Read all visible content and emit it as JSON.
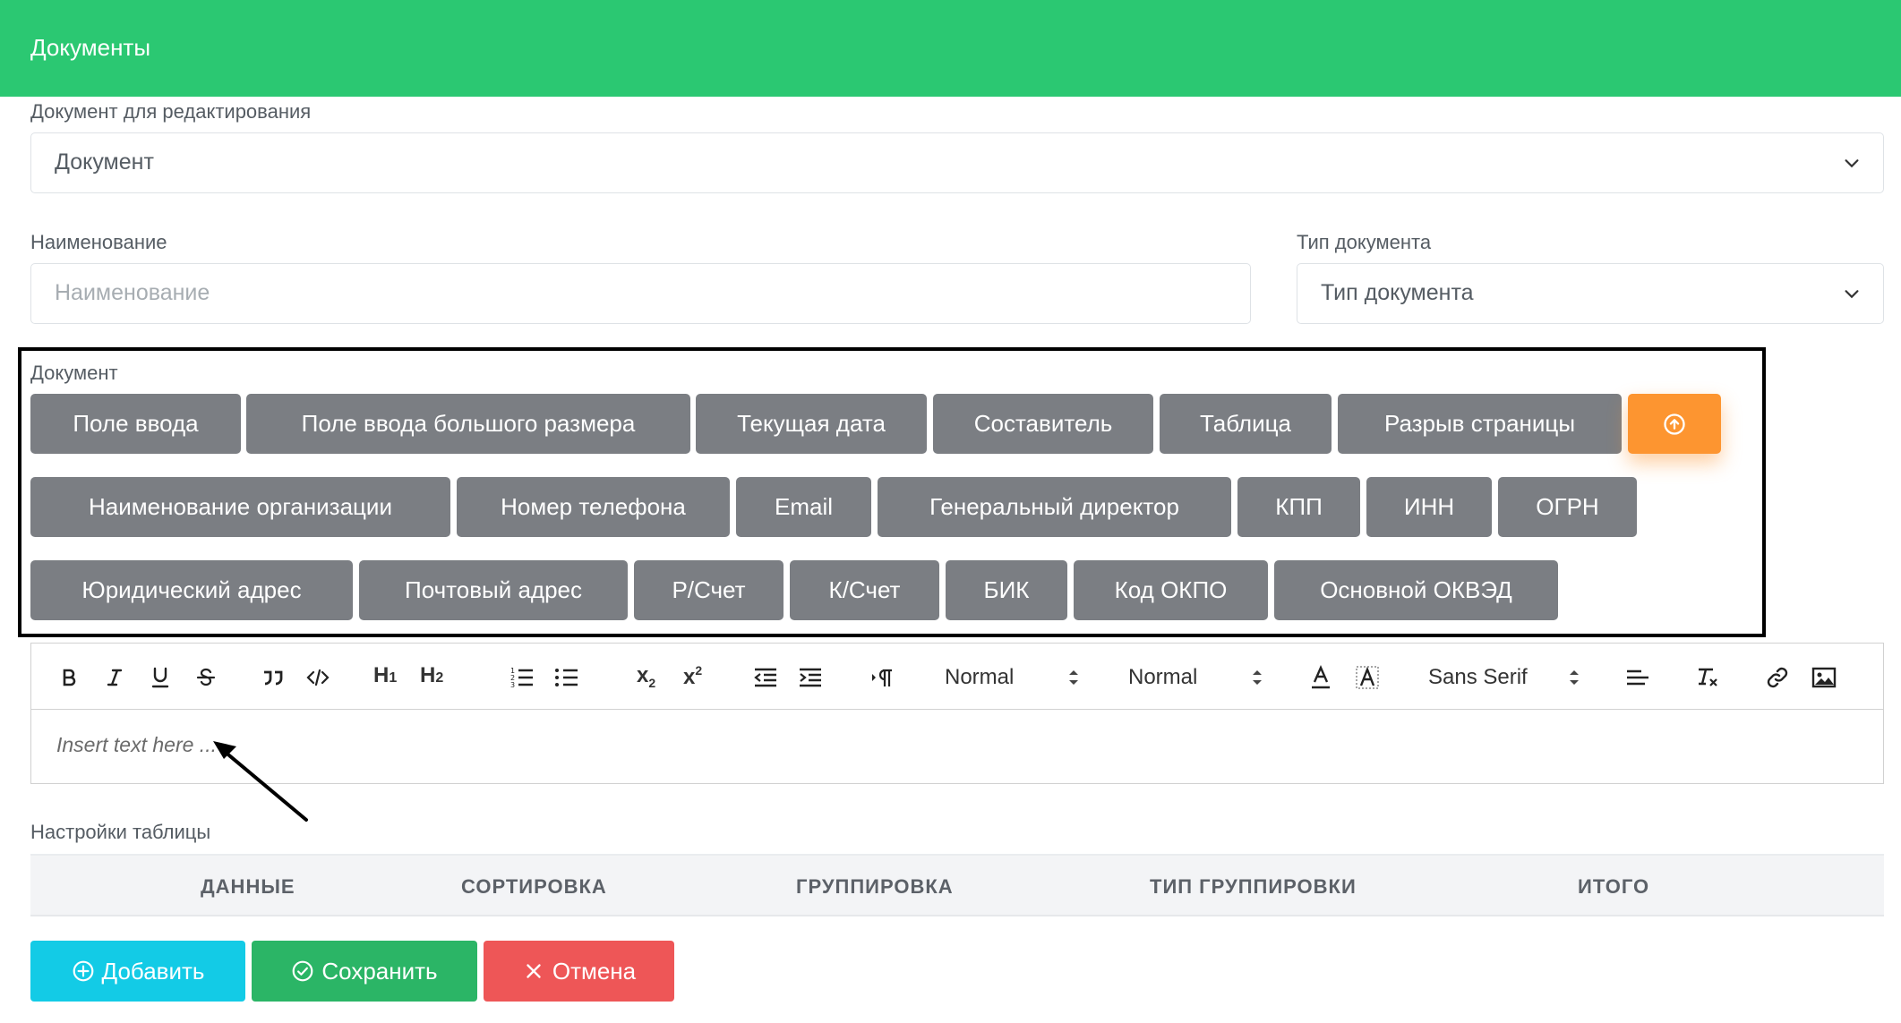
{
  "header": {
    "title": "Документы"
  },
  "doc_select": {
    "label": "Документ для редактирования",
    "value": "Документ"
  },
  "name_field": {
    "label": "Наименование",
    "placeholder": "Наименование"
  },
  "type_select": {
    "label": "Тип документа",
    "value": "Тип документа"
  },
  "document_section": {
    "label": "Документ",
    "row1": [
      "Поле ввода",
      "Поле ввода большого размера",
      "Текущая дата",
      "Составитель",
      "Таблица",
      "Разрыв страницы"
    ],
    "row2": [
      "Наименование организации",
      "Номер телефона",
      "Email",
      "Генеральный директор",
      "КПП",
      "ИНН",
      "ОГРН"
    ],
    "row3": [
      "Юридический адрес",
      "Почтовый адрес",
      "Р/Счет",
      "К/Счет",
      "БИК",
      "Код ОКПО",
      "Основной ОКВЭД"
    ],
    "upload_icon": "arrow-up-circle-icon"
  },
  "editor": {
    "header_picker": "Normal",
    "size_picker": "Normal",
    "font_picker": "Sans Serif",
    "placeholder": "Insert text here ..."
  },
  "table_settings": {
    "label": "Настройки таблицы",
    "columns": [
      "ДАННЫЕ",
      "СОРТИРОВКА",
      "ГРУППИРОВКА",
      "ТИП ГРУППИРОВКИ",
      "ИТОГО"
    ]
  },
  "actions": {
    "add": "Добавить",
    "save": "Сохранить",
    "cancel": "Отмена"
  },
  "colors": {
    "header": "#2bc872",
    "chip": "#7b7e83",
    "chip_accent": "#fd9530",
    "add": "#13cbe6",
    "save": "#2bb566",
    "cancel": "#ee5657"
  }
}
